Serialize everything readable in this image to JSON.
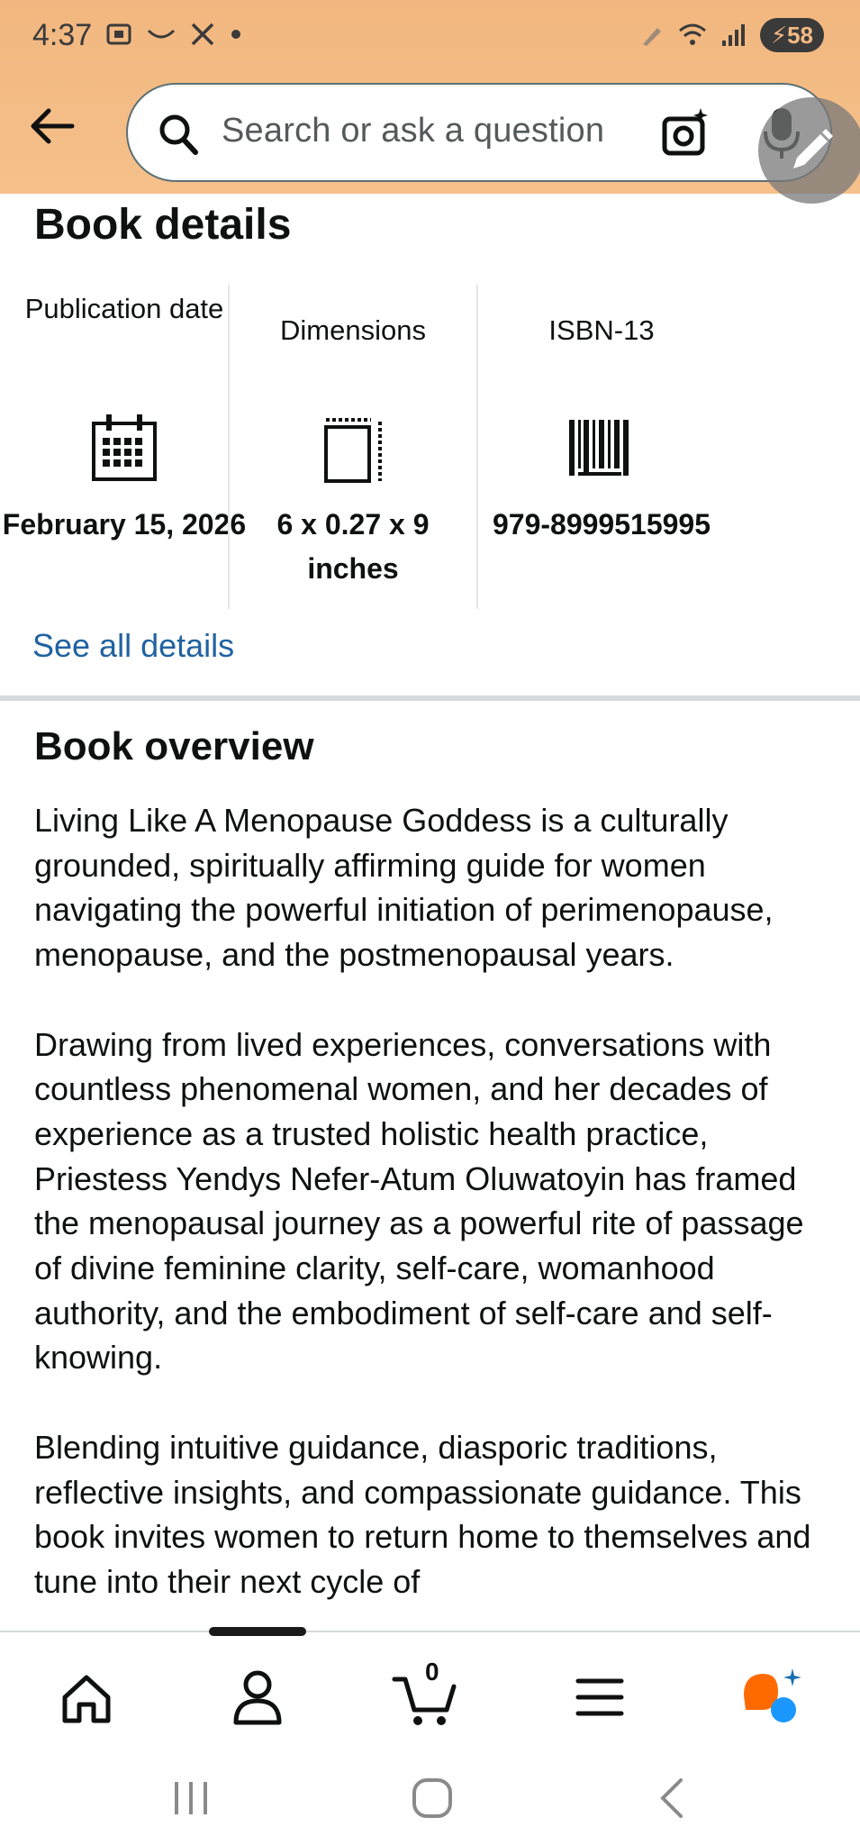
{
  "status_bar": {
    "time": "4:37",
    "battery": "58"
  },
  "search": {
    "placeholder": "Search or ask a question"
  },
  "book_details": {
    "title": "Book details",
    "columns": [
      {
        "label": "Publication date",
        "value": "February 15, 2026",
        "icon": "calendar-icon"
      },
      {
        "label": "Dimensions",
        "value": "6 x 0.27 x 9 inches",
        "icon": "dimensions-icon"
      },
      {
        "label": "ISBN-13",
        "value": "979-8999515995",
        "icon": "barcode-icon"
      }
    ],
    "see_all": "See all details"
  },
  "overview": {
    "title": "Book overview",
    "paragraphs": [
      "Living Like A Menopause Goddess is a culturally grounded, spiritually affirming guide for women navigating the powerful initiation of perimenopause, menopause, and the postmenopausal years.",
      "Drawing from lived experiences, conversations with countless phenomenal women, and her decades of experience as a trusted holistic health practice, Priestess Yendys Nefer-Atum Oluwatoyin has framed the menopausal journey as a powerful rite of passage of divine feminine clarity, self-care, womanhood authority, and the embodiment of self-care and self-knowing.",
      "Blending intuitive guidance, diasporic traditions, reflective insights, and compassionate guidance. This book invites women to return home to themselves and tune into their next cycle of"
    ]
  },
  "bottom_nav": {
    "cart_count": "0",
    "items": [
      "home-icon",
      "account-icon",
      "cart-icon",
      "menu-icon",
      "rufus-icon"
    ]
  },
  "colors": {
    "header_bg": "#f3ba85",
    "link": "#2162a1",
    "text": "#0f1111",
    "rufus_orange": "#ff6a00",
    "rufus_blue": "#1a98ff"
  }
}
